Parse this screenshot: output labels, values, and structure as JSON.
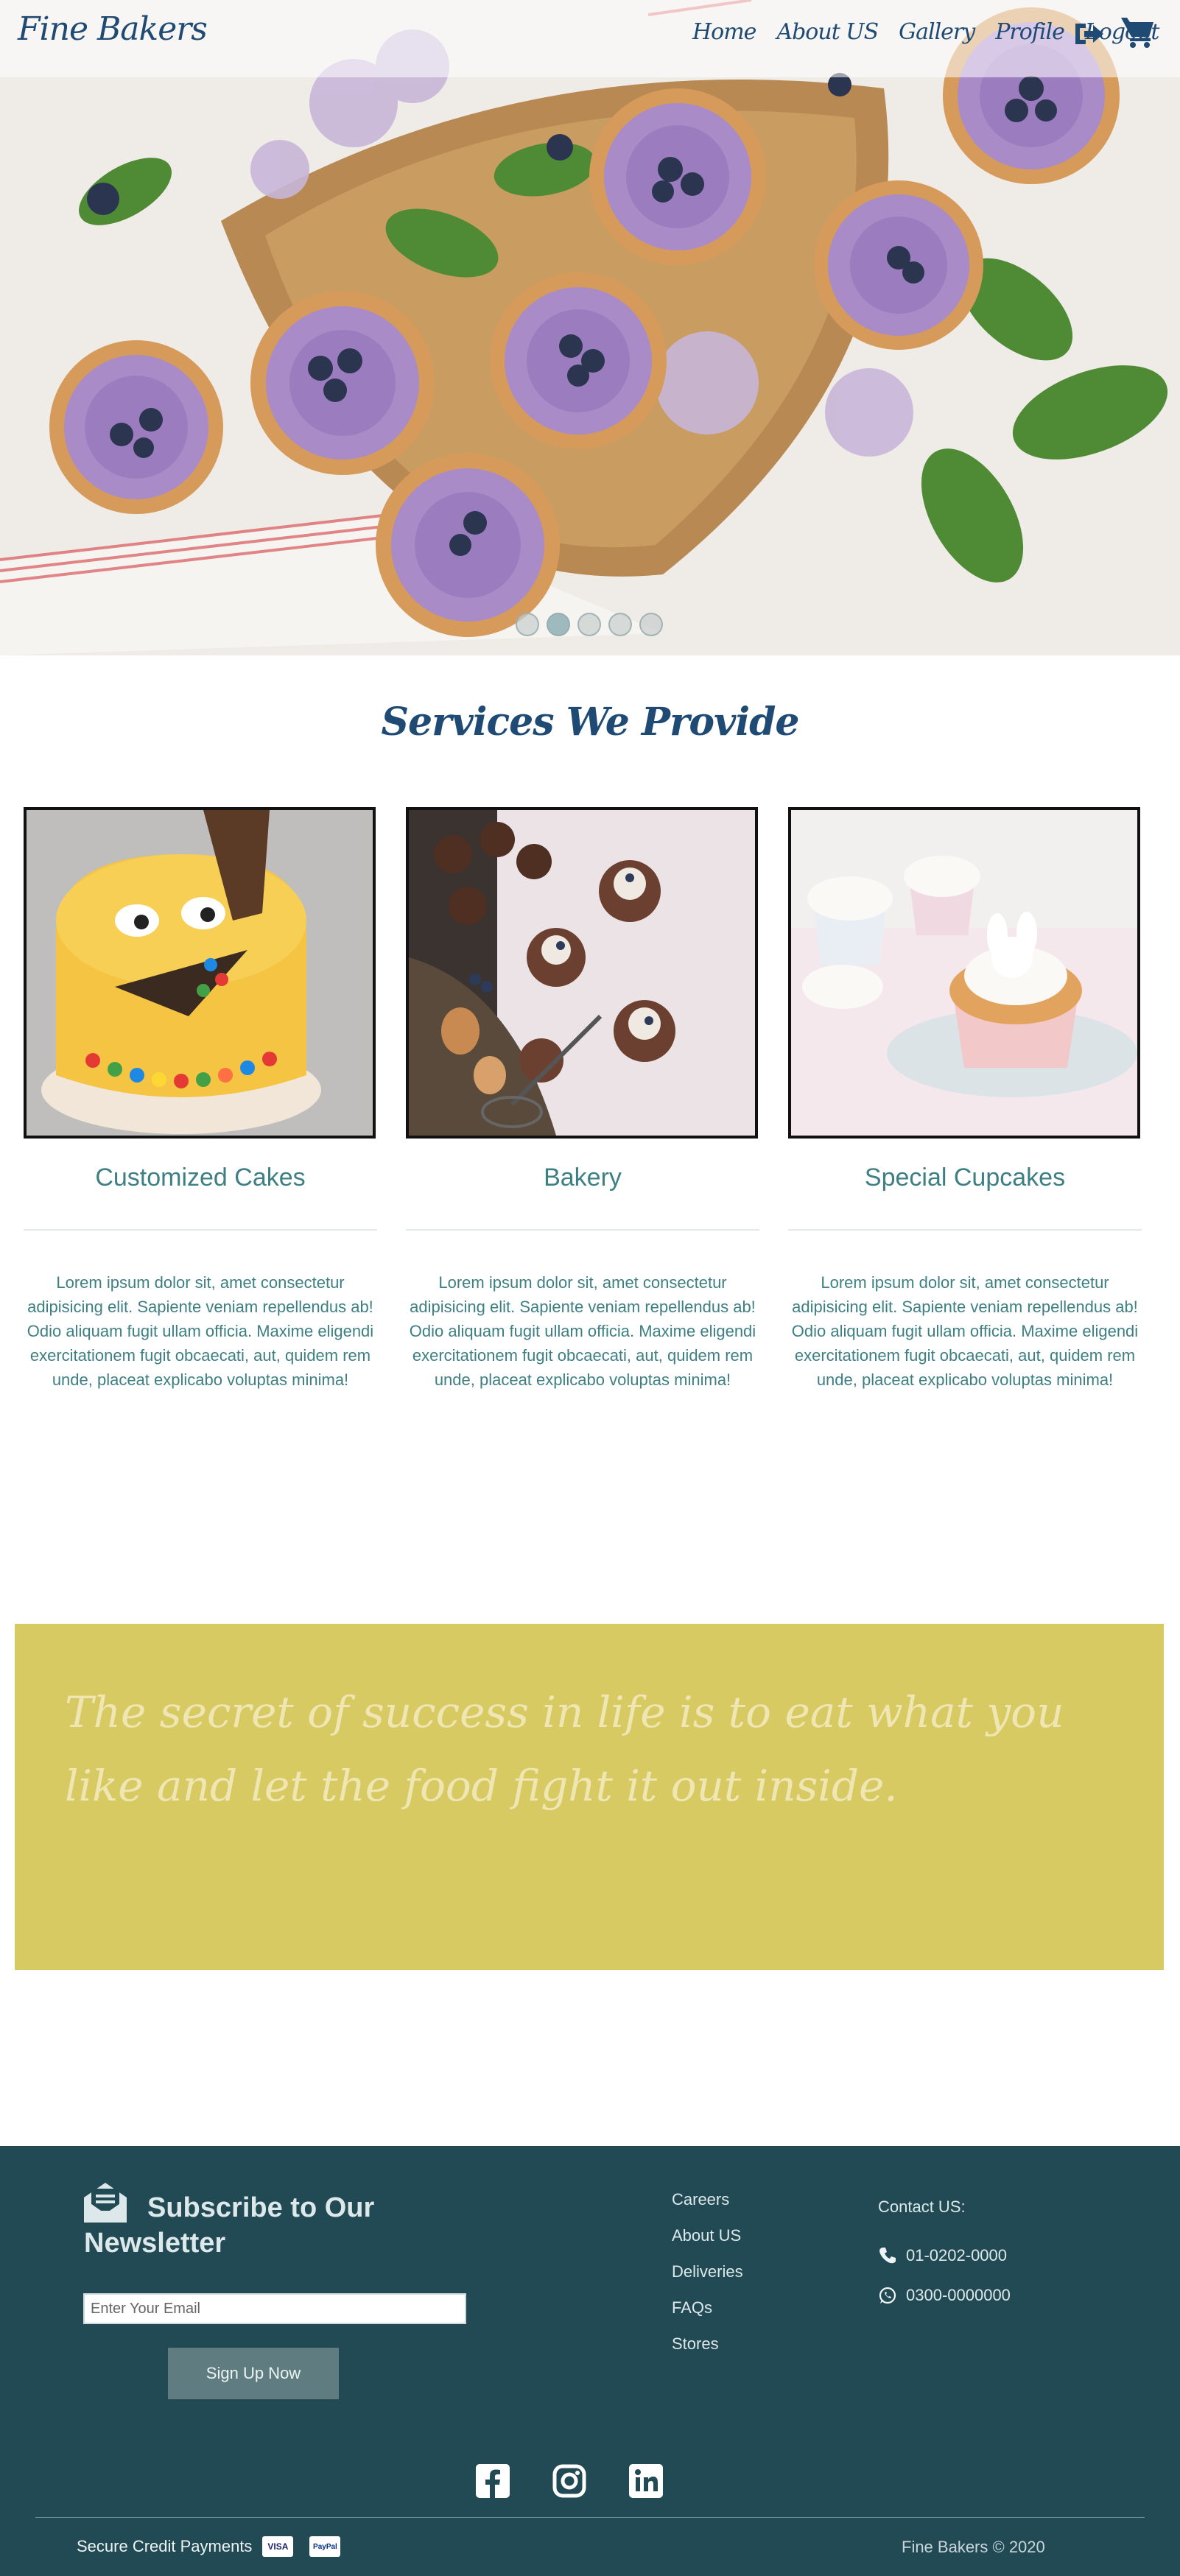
{
  "brand": "Fine Bakers",
  "nav": {
    "links": [
      "Home",
      "About US",
      "Gallery",
      "Profile",
      "Logout"
    ]
  },
  "icons": {
    "logout": "sign-out-icon",
    "cart": "shopping-cart-icon",
    "newsletter": "envelope-open-icon",
    "phone": "phone-icon",
    "whatsapp": "whatsapp-icon",
    "social": [
      "facebook-icon",
      "instagram-icon",
      "linkedin-icon"
    ]
  },
  "carousel": {
    "slide_count": 5,
    "active_index": 1
  },
  "services": {
    "title": "Services We Provide",
    "items": [
      {
        "name": "Customized Cakes",
        "text": "Lorem ipsum dolor sit, amet consectetur adipisicing elit. Sapiente veniam repellendus ab! Odio aliquam fugit ullam officia. Maxime eligendi exercitationem fugit obcaecati, aut, quidem rem unde, placeat explicabo voluptas minima!"
      },
      {
        "name": "Bakery",
        "text": "Lorem ipsum dolor sit, amet consectetur adipisicing elit. Sapiente veniam repellendus ab! Odio aliquam fugit ullam officia. Maxime eligendi exercitationem fugit obcaecati, aut, quidem rem unde, placeat explicabo voluptas minima!"
      },
      {
        "name": "Special Cupcakes",
        "text": "Lorem ipsum dolor sit, amet consectetur adipisicing elit. Sapiente veniam repellendus ab! Odio aliquam fugit ullam officia. Maxime eligendi exercitationem fugit obcaecati, aut, quidem rem unde, placeat explicabo voluptas minima!"
      }
    ]
  },
  "quote": "The secret of success in life is to eat what you like and let the food fight it out inside.",
  "footer": {
    "newsletter_title": "Subscribe to Our Newsletter",
    "email_placeholder": "Enter Your Email",
    "signup_label": "Sign Up Now",
    "links": [
      "Careers",
      "About US",
      "Deliveries",
      "FAQs",
      "Stores"
    ],
    "contact_title": "Contact US:",
    "phone": "01-0202-0000",
    "whatsapp": "0300-0000000",
    "payments_label": "Secure Credit Payments",
    "card_visa": "VISA",
    "card_paypal": "PayPal",
    "copyright": "Fine Bakers © 2020"
  },
  "colors": {
    "brand_navy": "#1f4a73",
    "teal_text": "#3e7f83",
    "quote_band": "#d8ca62",
    "footer_bg": "#224a54",
    "button_bg": "#5f7d80"
  }
}
